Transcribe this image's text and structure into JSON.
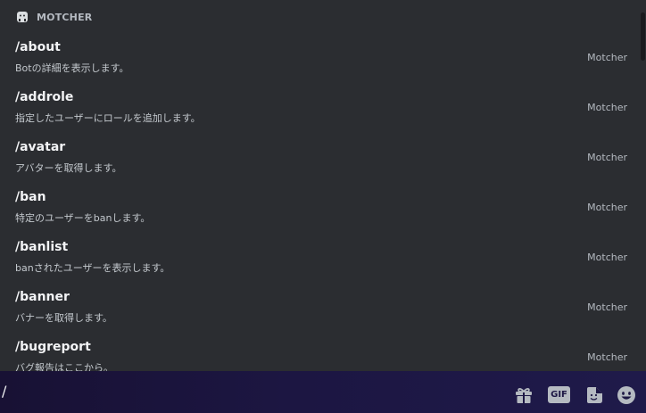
{
  "section": {
    "title": "MOTCHER"
  },
  "commands": [
    {
      "name": "/about",
      "description": "Botの詳細を表示します。",
      "source": "Motcher"
    },
    {
      "name": "/addrole",
      "description": "指定したユーザーにロールを追加します。",
      "source": "Motcher"
    },
    {
      "name": "/avatar",
      "description": "アバターを取得します。",
      "source": "Motcher"
    },
    {
      "name": "/ban",
      "description": "特定のユーザーをbanします。",
      "source": "Motcher"
    },
    {
      "name": "/banlist",
      "description": "banされたユーザーを表示します。",
      "source": "Motcher"
    },
    {
      "name": "/banner",
      "description": "バナーを取得します。",
      "source": "Motcher"
    },
    {
      "name": "/bugreport",
      "description": "バグ報告はここから。",
      "source": "Motcher"
    }
  ],
  "chat": {
    "input_value": "/",
    "gif_label": "GIF"
  },
  "icons": {
    "bot": "bot-icon",
    "gift": "gift-icon",
    "gif": "gif-icon",
    "sticker": "sticker-icon",
    "emoji": "emoji-icon"
  },
  "colors": {
    "popup_bg": "#2b2d31",
    "chat_bar_bg": "#1c1642",
    "text": "#f2f3f5",
    "muted": "#b5bac1"
  }
}
